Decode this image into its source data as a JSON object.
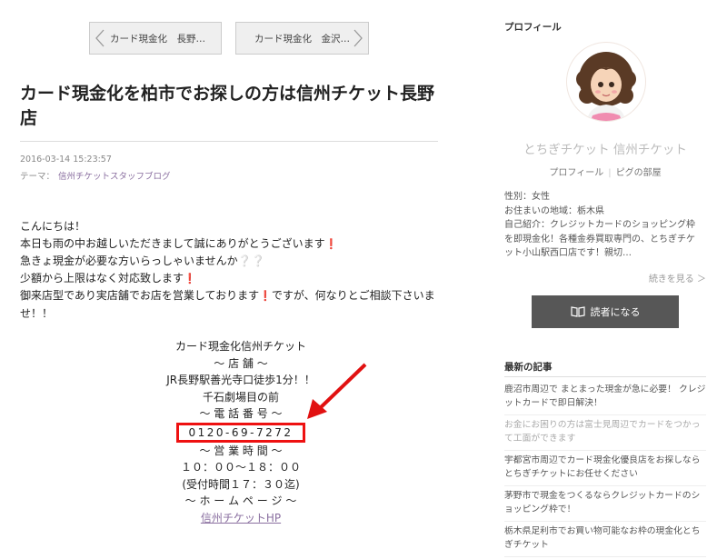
{
  "nav": {
    "prev_label": "カード現金化　長野…",
    "next_label": "カード現金化　金沢…"
  },
  "post": {
    "title": "カード現金化を柏市でお探しの方は信州チケット長野店",
    "date": "2016-03-14 15:23:57",
    "theme_label": "テーマ：",
    "theme_link": "信州チケットスタッフブログ",
    "body_lines": [
      "こんにちは！",
      "本日も雨の中お越しいただきまして誠にありがとうございます",
      "急きょ現金が必要な方いらっしゃいませんか",
      "少額から上限はなく対応致します",
      "御来店型であり実店舗でお店を営業しております",
      "ですが、何なりとご相談下さいま",
      "せ！！"
    ],
    "center_lines": [
      "カード現金化信州チケット",
      "～ 店 舗 ～",
      "JR長野駅善光寺口徒歩1分！！",
      "千石劇場目の前",
      "～ 電 話 番 号 ～"
    ],
    "phone": "0120-69-7272",
    "center_lines2": [
      "～ 営 業 時 間 ～",
      "１０：００～１８：００",
      "(受付時間１７：３０迄)",
      "～ ホ ー ム ペ ー ジ ～"
    ],
    "hp_link": "信州チケットHP"
  },
  "sidebar": {
    "profile_title": "プロフィール",
    "name": "とちぎチケット 信州チケット",
    "profile_link": "プロフィール",
    "room_link": "ピグの部屋",
    "info_lines": [
      "性別：女性",
      "お住まいの地域：栃木県",
      "自己紹介：クレジットカードのショッピング枠",
      "を即現金化！各種金券買取専門の、とちぎチケ",
      "ット小山駅西口店です！親切…"
    ],
    "more_label": "続きを見る ＞",
    "reader_button": "読者になる",
    "recent_title": "最新の記事",
    "recent_items": [
      {
        "text": "鹿沼市周辺で まとまった現金が急に必要！ クレジットカードで即日解決！",
        "dim": false
      },
      {
        "text": "お金にお困りの方は富士見周辺でカードをつかって工面ができます",
        "dim": true
      },
      {
        "text": "宇都宮市周辺でカード現金化優良店をお探しならとちぎチケットにお任せください",
        "dim": false
      },
      {
        "text": "茅野市で現金をつくるならクレジットカードのショッピング枠で！",
        "dim": false
      },
      {
        "text": "栃木県足利市でお買い物可能なお枠の現金化とちぎチケット",
        "dim": false
      }
    ]
  },
  "colors": {
    "annotation_red": "#e11111",
    "link_purple": "#8a6fa0",
    "button_dark": "#575757"
  },
  "icons": [
    "chevron-left-icon",
    "chevron-right-icon",
    "pin-icon",
    "sparkle-icon",
    "book-icon",
    "arrow-icon"
  ]
}
